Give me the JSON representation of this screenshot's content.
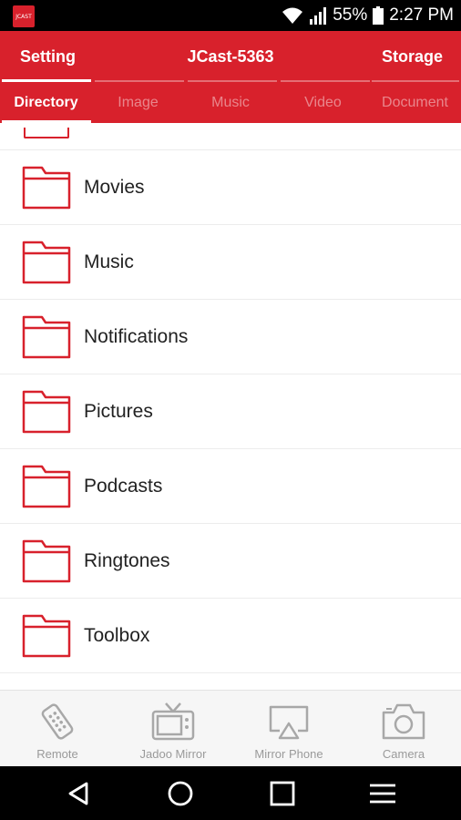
{
  "status_bar": {
    "app_icon_text": "JCAST",
    "battery": "55%",
    "time": "2:27 PM"
  },
  "header": {
    "left_label": "Setting",
    "title": "JCast-5363",
    "right_label": "Storage"
  },
  "tabs": [
    {
      "label": "Directory",
      "active": true
    },
    {
      "label": "Image",
      "active": false
    },
    {
      "label": "Music",
      "active": false
    },
    {
      "label": "Video",
      "active": false
    },
    {
      "label": "Document",
      "active": false
    }
  ],
  "folders": [
    {
      "name": "Movies"
    },
    {
      "name": "Music"
    },
    {
      "name": "Notifications"
    },
    {
      "name": "Pictures"
    },
    {
      "name": "Podcasts"
    },
    {
      "name": "Ringtones"
    },
    {
      "name": "Toolbox"
    }
  ],
  "bottom_nav": [
    {
      "label": "Remote",
      "icon": "remote-icon"
    },
    {
      "label": "Jadoo Mirror",
      "icon": "tv-icon"
    },
    {
      "label": "Mirror Phone",
      "icon": "airplay-icon"
    },
    {
      "label": "Camera",
      "icon": "camera-icon"
    }
  ],
  "colors": {
    "accent": "#d8212c",
    "inactive_tab_text": "#f0a0a5",
    "nav_icon": "#a8a8a8"
  }
}
